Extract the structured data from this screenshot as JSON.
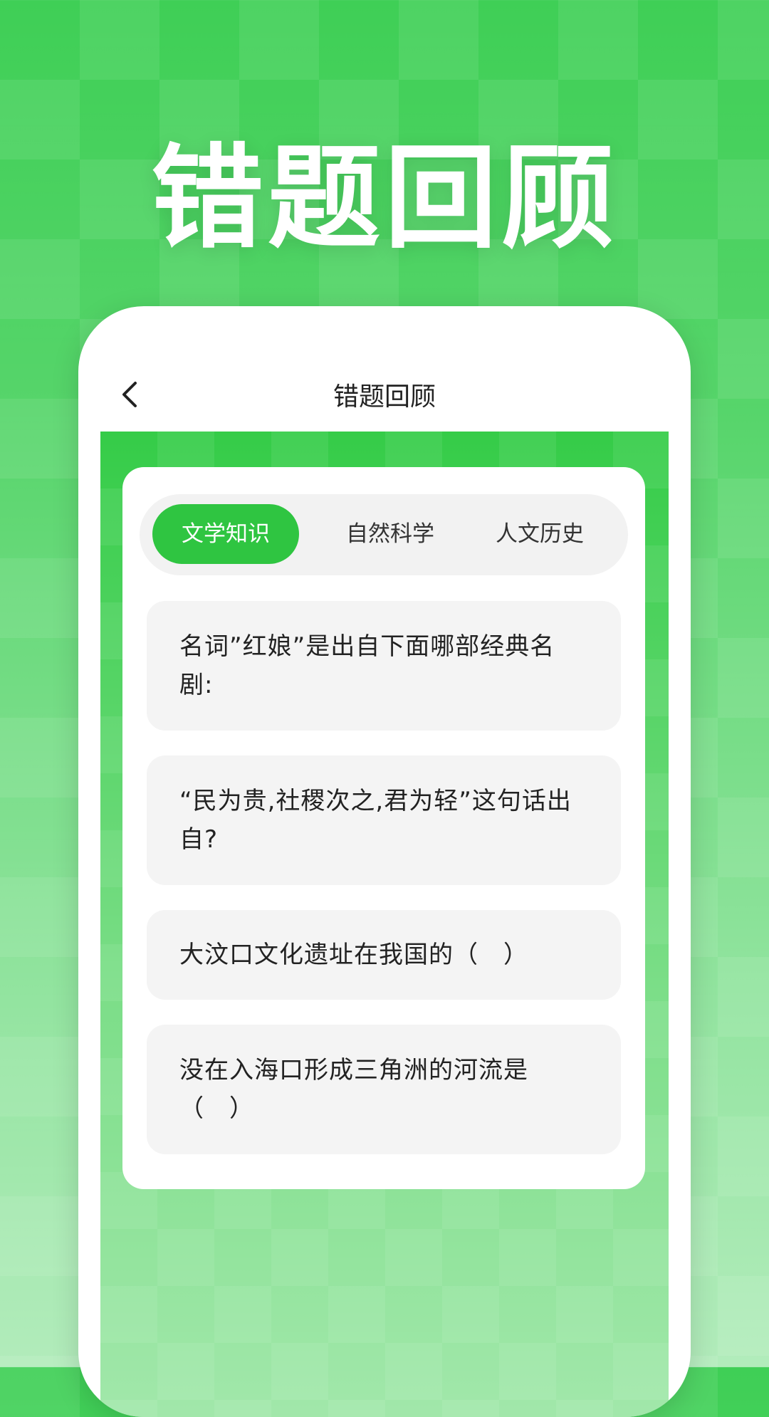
{
  "hero": {
    "title": "错题回顾"
  },
  "nav": {
    "title": "错题回顾"
  },
  "tabs": [
    {
      "label": "文学知识",
      "active": true
    },
    {
      "label": "自然科学",
      "active": false
    },
    {
      "label": "人文历史",
      "active": false
    }
  ],
  "questions": [
    {
      "text": "名词”红娘”是出自下面哪部经典名剧:"
    },
    {
      "text": "“民为贵,社稷次之,君为轻”这句话出自?"
    },
    {
      "text": "大汶口文化遗址在我国的（　）"
    },
    {
      "text": "没在入海口形成三角洲的河流是（　）"
    }
  ],
  "colors": {
    "accent": "#2fc541",
    "background": "#3fcf56"
  }
}
